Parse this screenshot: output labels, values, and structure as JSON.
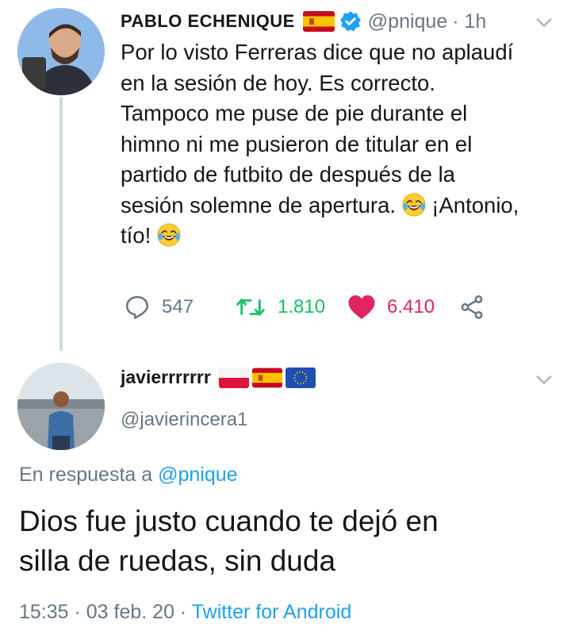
{
  "original_tweet": {
    "display_name": "PABLO ECHENIQUE",
    "handle": "@pnique",
    "time": "· 1h",
    "text": "Por lo visto Ferreras dice que no aplaudí\nen la sesión de hoy. Es correcto.\nTampoco me puse de pie durante el\nhimno ni me pusieron de titular en el\npartido de futbito de después de la\nsesión solemne de apertura.",
    "text_after_emoji": " ¡Antonio,\ntío! ",
    "replies": "547",
    "retweets": "1.810",
    "likes": "6.410",
    "icons": [
      "spain-flag-icon",
      "verified-icon",
      "chevron-down-icon",
      "reply-icon",
      "retweet-icon",
      "heart-icon",
      "share-icon",
      "laughing-emoji-icon"
    ]
  },
  "reply_tweet": {
    "display_name": "javierrrrrrr",
    "handle": "@javierincera1",
    "reply_prefix": "En respuesta a ",
    "reply_to": "@pnique",
    "text": "Dios fue justo cuando te dejó en\nsilla de ruedas, sin duda",
    "time": "15:35 · 03 feb. 20 · ",
    "source": "Twitter for Android",
    "icons": [
      "poland-flag-icon",
      "spain-flag-icon",
      "eu-flag-icon",
      "chevron-down-icon"
    ]
  },
  "colors": {
    "text": "#14171a",
    "muted": "#657786",
    "link": "#1da1f2",
    "retweet": "#17bf63",
    "like": "#e0245e",
    "thread_line": "#cfd9de"
  }
}
